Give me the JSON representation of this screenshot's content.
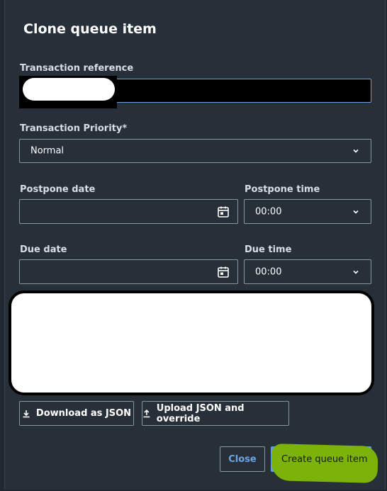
{
  "dialog": {
    "title": "Clone queue item",
    "transaction_reference": {
      "label": "Transaction reference",
      "value": ""
    },
    "priority": {
      "label": "Transaction Priority*",
      "value": "Normal"
    },
    "postpone_date": {
      "label": "Postpone date",
      "value": ""
    },
    "postpone_time": {
      "label": "Postpone time",
      "value": "00:00"
    },
    "due_date": {
      "label": "Due date",
      "value": ""
    },
    "due_time": {
      "label": "Due time",
      "value": "00:00"
    },
    "download_label": "Download as JSON",
    "upload_label": "Upload JSON and override",
    "close_label": "Close",
    "create_label": "Create queue item"
  },
  "colors": {
    "background": "#273039",
    "accent": "#5aa0e8",
    "border": "#8a96a2",
    "highlight_mark": "#7cb30a"
  }
}
